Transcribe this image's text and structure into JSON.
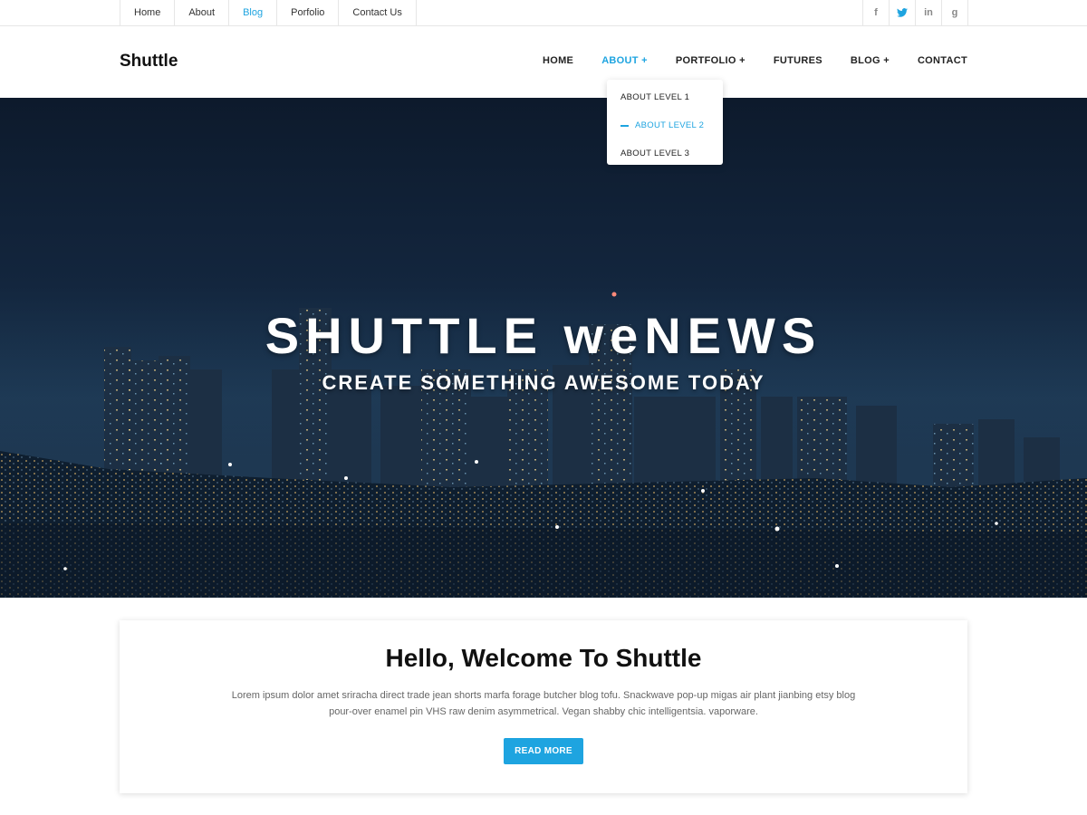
{
  "topbar": {
    "links": [
      {
        "label": "Home"
      },
      {
        "label": "About"
      },
      {
        "label": "Blog"
      },
      {
        "label": "Porfolio"
      },
      {
        "label": "Contact Us"
      }
    ],
    "social": [
      {
        "icon": "facebook-icon",
        "glyph": "f"
      },
      {
        "icon": "twitter-icon",
        "glyph": "t"
      },
      {
        "icon": "linkedin-icon",
        "glyph": "in"
      },
      {
        "icon": "google-icon",
        "glyph": "g"
      }
    ]
  },
  "header": {
    "brand": "Shuttle",
    "nav": [
      {
        "label": "HOME"
      },
      {
        "label": "ABOUT +"
      },
      {
        "label": "PORTFOLIO +"
      },
      {
        "label": "FUTURES"
      },
      {
        "label": "BLOG +"
      },
      {
        "label": "CONTACT"
      }
    ],
    "dropdown": [
      {
        "label": "ABOUT LEVEL 1"
      },
      {
        "label": "ABOUT LEVEL 2"
      },
      {
        "label": "ABOUT LEVEL 3"
      }
    ]
  },
  "hero": {
    "title": "SHUTTLE weNEWS",
    "subtitle": "CREATE SOMETHING AWESOME TODAY"
  },
  "welcome": {
    "heading": "Hello, Welcome To Shuttle",
    "body_line1": "Lorem ipsum dolor amet sriracha direct trade jean shorts marfa forage butcher blog tofu. Snackwave pop-up migas air plant  jianbing etsy blog",
    "body_line2": "pour-over enamel pin VHS raw denim asymmetrical. Vegan shabby chic intelligentsia. vaporware.",
    "button": "READ MORE"
  },
  "colors": {
    "accent": "#1ea4e0",
    "text": "#222222"
  }
}
